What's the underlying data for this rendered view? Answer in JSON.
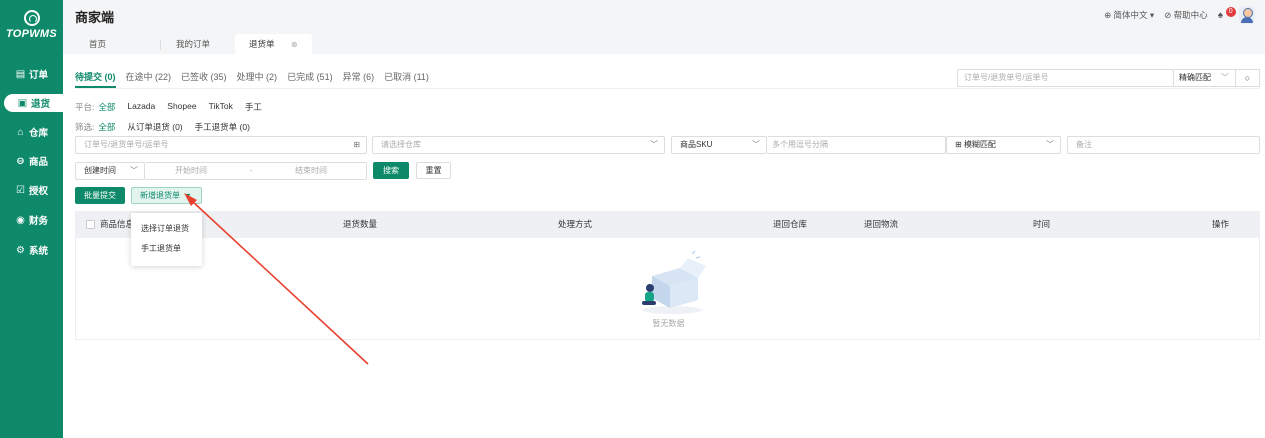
{
  "sidebar": {
    "logo_text": "TOPWMS",
    "items": [
      {
        "icon": "▤",
        "label": "订单"
      },
      {
        "icon": "▣",
        "label": "退货"
      },
      {
        "icon": "⌂",
        "label": "仓库"
      },
      {
        "icon": "⊖",
        "label": "商品"
      },
      {
        "icon": "☑",
        "label": "授权"
      },
      {
        "icon": "◉",
        "label": "财务"
      },
      {
        "icon": "⚙",
        "label": "系统"
      }
    ]
  },
  "header": {
    "title": "商家端",
    "language": "⊕ 简体中文 ▾",
    "help": "⊘ 帮助中心",
    "bell_icon": "♠",
    "badge": "0"
  },
  "page_tabs": [
    {
      "label": "首页"
    },
    {
      "label": "我的订单"
    },
    {
      "label": "退货单",
      "close": "⊗"
    }
  ],
  "status_tabs": [
    {
      "label": "待提交 (0)"
    },
    {
      "label": "在途中 (22)"
    },
    {
      "label": "已签收 (35)"
    },
    {
      "label": "处理中 (2)"
    },
    {
      "label": "已完成 (51)"
    },
    {
      "label": "异常 (6)"
    },
    {
      "label": "已取消 (11)"
    }
  ],
  "top_search": {
    "placeholder": "订单号/退货单号/运单号",
    "match": "精确匹配",
    "match_arrow": "﹀",
    "icon": "○"
  },
  "platform_filter": {
    "label": "平台:",
    "options": [
      "全部",
      "Lazada",
      "Shopee",
      "TikTok",
      "手工"
    ]
  },
  "source_filter": {
    "label": "筛选:",
    "options": [
      "全部",
      "从订单退货 (0)",
      "手工退货单 (0)"
    ]
  },
  "filters": {
    "order_no_placeholder": "订单号/退货单号/运单号",
    "order_no_icon": "⊞",
    "warehouse_placeholder": "请选择仓库",
    "warehouse_arrow": "﹀",
    "sku_type": "商品SKU",
    "sku_arrow": "﹀",
    "sku_placeholder": "多个用逗号分隔",
    "match_icon": "⊞",
    "match": "模糊匹配",
    "match_arrow": "﹀",
    "remark_placeholder": "备注",
    "time_type": "创建时间",
    "time_arrow": "﹀",
    "start_placeholder": "开始时间",
    "dash": "-",
    "end_placeholder": "结束时间",
    "search": "搜索",
    "reset": "重置"
  },
  "actions": {
    "batch_submit": "批量提交",
    "new_return": "新增退货单",
    "new_return_arrow": "▾"
  },
  "dropdown": {
    "items": [
      "选择订单退货",
      "手工退货单"
    ]
  },
  "table": {
    "columns": [
      "商品信息",
      "退货数量",
      "处理方式",
      "退回仓库",
      "退回物流",
      "时间",
      "操作"
    ],
    "empty_text": "暂无数据"
  }
}
